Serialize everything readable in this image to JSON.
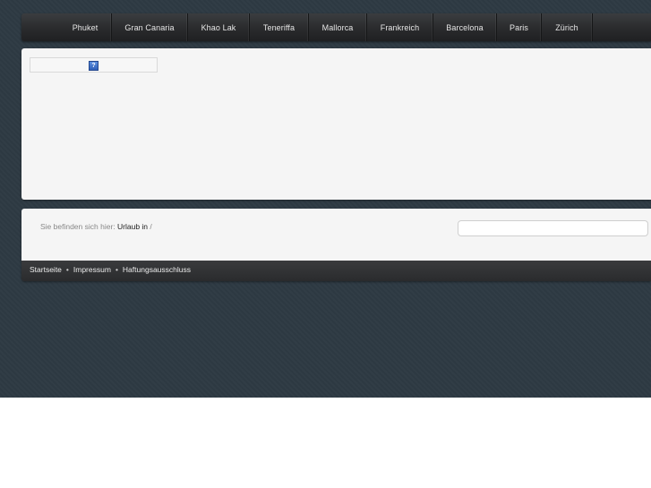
{
  "nav": {
    "items": [
      {
        "label": "Phuket"
      },
      {
        "label": "Gran Canaria"
      },
      {
        "label": "Khao Lak"
      },
      {
        "label": "Teneriffa"
      },
      {
        "label": "Mallorca"
      },
      {
        "label": "Frankreich"
      },
      {
        "label": "Barcelona"
      },
      {
        "label": "Paris"
      },
      {
        "label": "Zürich"
      }
    ]
  },
  "widget": {
    "icon": "question-icon",
    "icon_glyph": "?"
  },
  "breadcrumb": {
    "prefix": "Sie befinden sich hier:",
    "link": "Urlaub in",
    "separator": "/"
  },
  "search": {
    "value": "",
    "placeholder": ""
  },
  "footer": {
    "links": [
      "Startseite",
      "Impressum",
      "Haftungsausschluss"
    ],
    "separator": "•"
  },
  "colors": {
    "background": "#2e3a43",
    "nav_bar": "#2b2c2e",
    "panel": "#f5f5f5",
    "footer_bar": "#2a2b2d"
  }
}
